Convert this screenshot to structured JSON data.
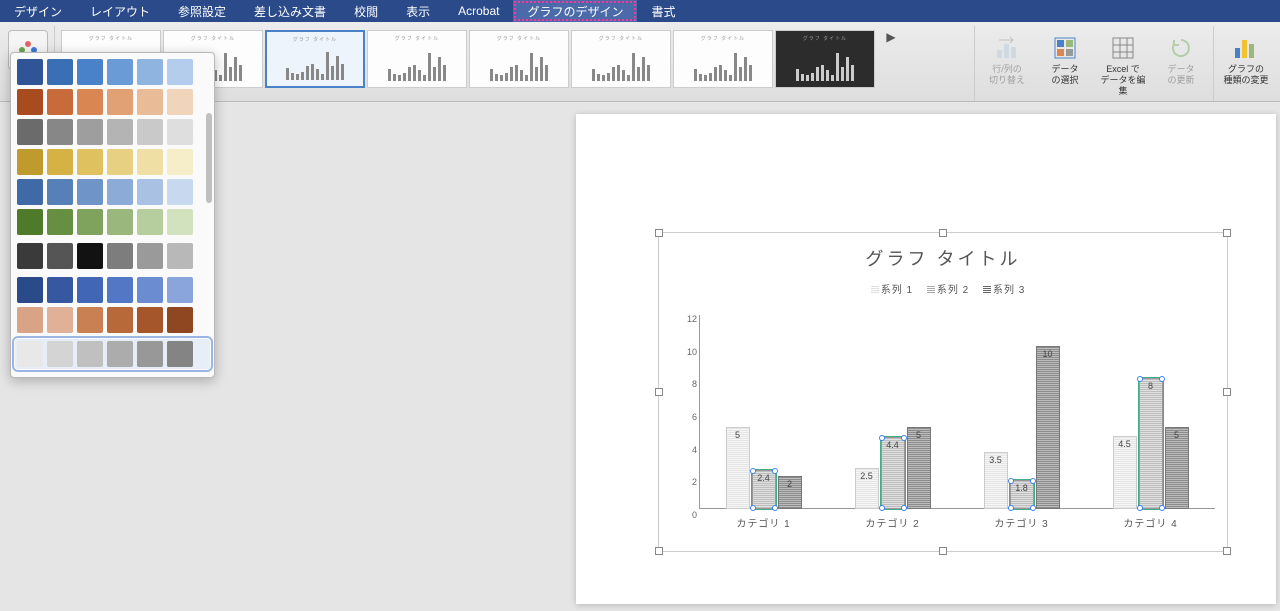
{
  "menubar": {
    "items": [
      "デザイン",
      "レイアウト",
      "参照設定",
      "差し込み文書",
      "校閲",
      "表示",
      "Acrobat",
      "グラフのデザイン",
      "書式"
    ],
    "active_index": 7
  },
  "ribbon": {
    "style_thumb_label": "グラフ タイトル",
    "buttons": {
      "switch": "行/列の\n切り替え",
      "select_data": "データ\nの選択",
      "edit_excel": "Excel で\nデータを編集",
      "refresh": "データ\nの更新",
      "change_type": "グラフの\n種類の変更"
    }
  },
  "palette": {
    "rows": [
      [
        "#2f5597",
        "#3b6fb5",
        "#4a82c9",
        "#6a9bd6",
        "#8fb4e0",
        "#b5cdec"
      ],
      [
        "#a84b1e",
        "#c96a3a",
        "#d98652",
        "#e2a174",
        "#e9bb97",
        "#f0d5bb"
      ],
      [
        "#6b6b6b",
        "#878787",
        "#9e9e9e",
        "#b4b4b4",
        "#c9c9c9",
        "#dedede"
      ],
      [
        "#bf9a2d",
        "#d6b245",
        "#e0c160",
        "#e8d082",
        "#efdfa5",
        "#f6eec9"
      ],
      [
        "#3f6aa6",
        "#577fb8",
        "#6f94c8",
        "#8cabd6",
        "#a9c2e3",
        "#c7d9ef"
      ],
      [
        "#4e7a2a",
        "#668f42",
        "#7fa35c",
        "#9ab87c",
        "#b6cd9d",
        "#d2e2bf"
      ],
      [
        "#3a3a3a",
        "#555555",
        "#121212",
        "#7d7d7d",
        "#9a9a9a",
        "#b8b8b8"
      ],
      [
        "#2a4a8a",
        "#3558a0",
        "#4066b5",
        "#5278c5",
        "#6b8cd0",
        "#8aa4dc"
      ],
      [
        "#d9a385",
        "#e0b197",
        "#c98153",
        "#b8693a",
        "#a5562b",
        "#8e4721"
      ],
      [
        "#e8e8e8",
        "#d4d4d4",
        "#c0c0c0",
        "#acacac",
        "#989898",
        "#848484"
      ]
    ],
    "dividers_after": [
      5,
      6,
      8
    ],
    "selected_row": 9
  },
  "chart_data": {
    "type": "bar",
    "title": "グラフ タイトル",
    "legend": [
      "系列 1",
      "系列 2",
      "系列 3"
    ],
    "categories": [
      "カテゴリ 1",
      "カテゴリ 2",
      "カテゴリ 3",
      "カテゴリ 4"
    ],
    "series": [
      {
        "name": "系列 1",
        "values": [
          5,
          2.5,
          3.5,
          4.5
        ]
      },
      {
        "name": "系列 2",
        "values": [
          2.4,
          4.4,
          1.8,
          8
        ]
      },
      {
        "name": "系列 3",
        "values": [
          2,
          5,
          10,
          5
        ]
      }
    ],
    "ylim": [
      0,
      12
    ],
    "y_ticks": [
      0,
      2,
      4,
      6,
      8,
      10,
      12
    ],
    "selected_series_index": 1,
    "xlabel": "",
    "ylabel": ""
  }
}
